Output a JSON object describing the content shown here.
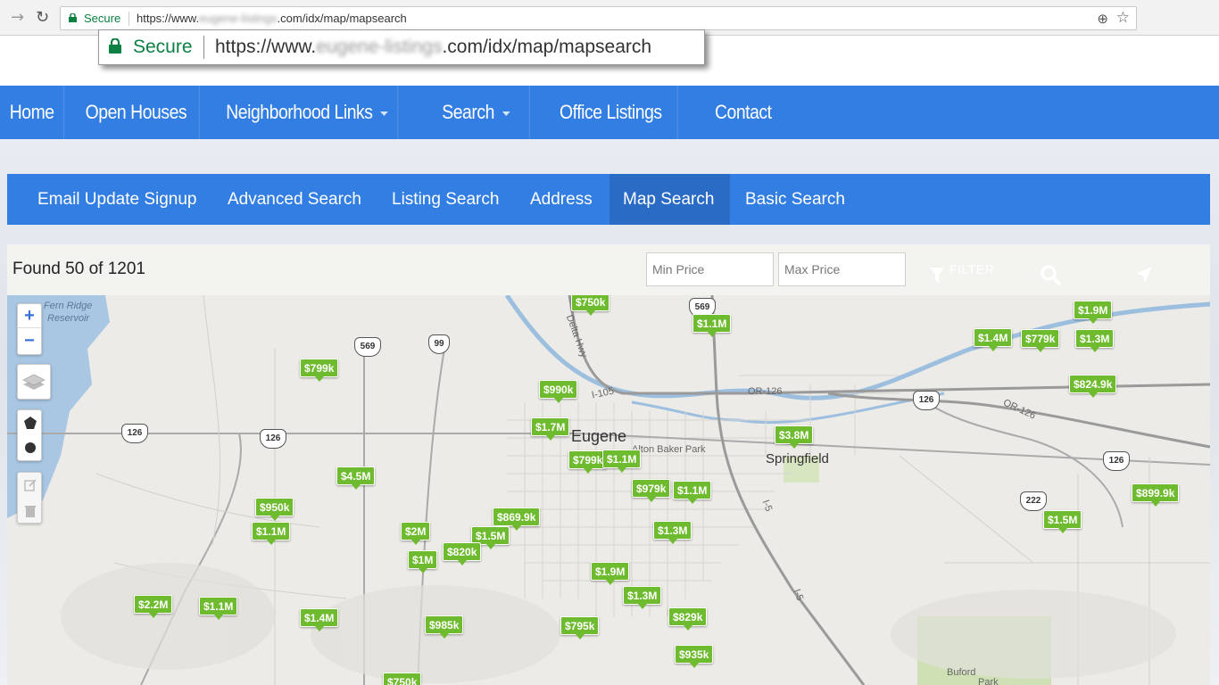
{
  "browser": {
    "secure_label": "Secure",
    "url_prefix": "https://www.",
    "url_blurred": "eugene-listings",
    "url_suffix": ".com/idx/map/mapsearch"
  },
  "callout": {
    "secure_label": "Secure",
    "url_prefix": "https://www.",
    "url_blurred": "eugene-listings",
    "url_suffix": ".com/idx/map/mapsearch"
  },
  "main_nav": {
    "items": [
      {
        "label": "Home"
      },
      {
        "label": "Open Houses"
      },
      {
        "label": "Neighborhood Links"
      },
      {
        "label": "Search"
      },
      {
        "label": "Office Listings"
      },
      {
        "label": "Contact"
      }
    ]
  },
  "sub_nav": {
    "items": [
      {
        "label": "Email Update Signup"
      },
      {
        "label": "Advanced Search"
      },
      {
        "label": "Listing Search"
      },
      {
        "label": "Address"
      },
      {
        "label": "Map Search"
      },
      {
        "label": "Basic Search"
      }
    ],
    "active": "Map Search"
  },
  "search": {
    "found_text": "Found 50 of 1201",
    "min_price_placeholder": "Min Price",
    "max_price_placeholder": "Max Price",
    "filter_label": "FILTER"
  },
  "map": {
    "labels": {
      "eugene": "Eugene",
      "springfield": "Springfield",
      "alton_baker": "Alton Baker Park",
      "fern_ridge": "Fern Ridge",
      "reservoir": "Reservoir",
      "delta_hwy": "Delta Hwy",
      "i105": "I-105",
      "or126_a": "OR-126",
      "or126_b": "OR-126",
      "i5_a": "I-5",
      "i5_b": "I-5",
      "buford": "Buford",
      "buford_park": "Park"
    },
    "shields": [
      "569",
      "569",
      "99",
      "126",
      "126",
      "126",
      "126",
      "222"
    ],
    "zoom_in": "+",
    "zoom_out": "−",
    "markers": [
      "$750k",
      "$1.1M",
      "$1.9M",
      "$1.4M",
      "$779k",
      "$1.3M",
      "$799k",
      "$824.9k",
      "$990k",
      "$1.7M",
      "$3.8M",
      "$799k",
      "$1.1M",
      "$4.5M",
      "$979k",
      "$1.1M",
      "$899.9k",
      "$950k",
      "$869.9k",
      "$1.5M",
      "$1.1M",
      "$2M",
      "$1.5M",
      "$820k",
      "$1.3M",
      "$1M",
      "$1.9M",
      "$1.3M",
      "$2.2M",
      "$1.1M",
      "$1.4M",
      "$985k",
      "$795k",
      "$829k",
      "$935k",
      "$750k"
    ]
  },
  "icons": {
    "lock": "lock-icon",
    "back": "back-arrow-icon",
    "reload": "reload-icon",
    "zoom": "zoom-icon",
    "star": "bookmark-star-icon",
    "filter": "filter-icon",
    "search": "search-icon",
    "locate": "locate-arrow-icon",
    "layers": "layers-icon",
    "polygon": "polygon-draw-icon",
    "circle": "circle-draw-icon",
    "edit": "edit-icon",
    "trash": "trash-icon"
  },
  "colors": {
    "nav_blue": "#337ee3",
    "nav_active": "#2a6bc6",
    "marker_green": "#6fbb2f",
    "secure_green": "#0b8043"
  }
}
